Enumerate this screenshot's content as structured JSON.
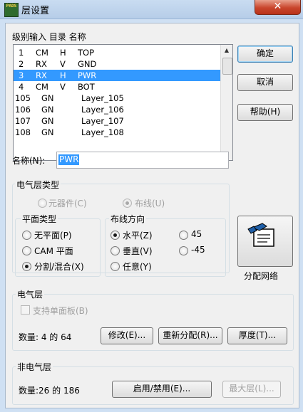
{
  "window": {
    "title": "层设置",
    "app_icon": "PADS",
    "close": "✕"
  },
  "layers_header": "级别输入  目录  名称",
  "layers": [
    {
      "num": "1",
      "type": "CM",
      "dir": "H",
      "name": "TOP",
      "selected": false
    },
    {
      "num": "2",
      "type": "RX",
      "dir": "V",
      "name": "GND",
      "selected": false
    },
    {
      "num": "3",
      "type": "RX",
      "dir": "H",
      "name": "PWR",
      "selected": true
    },
    {
      "num": "4",
      "type": "CM",
      "dir": "V",
      "name": "BOT",
      "selected": false
    },
    {
      "num": "105",
      "type": "GN",
      "dir": "",
      "name": "Layer_105",
      "selected": false
    },
    {
      "num": "106",
      "type": "GN",
      "dir": "",
      "name": "Layer_106",
      "selected": false
    },
    {
      "num": "107",
      "type": "GN",
      "dir": "",
      "name": "Layer_107",
      "selected": false
    },
    {
      "num": "108",
      "type": "GN",
      "dir": "",
      "name": "Layer_108",
      "selected": false
    }
  ],
  "buttons": {
    "ok": "确定",
    "cancel": "取消",
    "help": "帮助(H)"
  },
  "name_field": {
    "label": "名称(N):",
    "value": "PWR"
  },
  "electrical_type": {
    "title": "电气层类型",
    "component": "元器件(C)",
    "routing": "布线(U)"
  },
  "plane_type": {
    "title": "平面类型",
    "none": "无平面(P)",
    "cam": "CAM 平面",
    "split": "分割/混合(X)"
  },
  "routing_dir": {
    "title": "布线方向",
    "horizontal": "水平(Z)",
    "vertical": "垂直(V)",
    "any": "任意(Y)",
    "d45": "45",
    "dm45": "-45"
  },
  "assign_nets": {
    "label": "分配网络"
  },
  "electrical_layers": {
    "title": "电气层",
    "single_sided": "支持单面板(B)",
    "count": "数量: 4 的 64",
    "modify": "修改(E)...",
    "reassign": "重新分配(R)...",
    "thickness": "厚度(T)..."
  },
  "non_electrical": {
    "title": "非电气层",
    "count": "数量:26 的 186",
    "enable": "启用/禁用(E)...",
    "max_layers": "最大层(L)..."
  }
}
